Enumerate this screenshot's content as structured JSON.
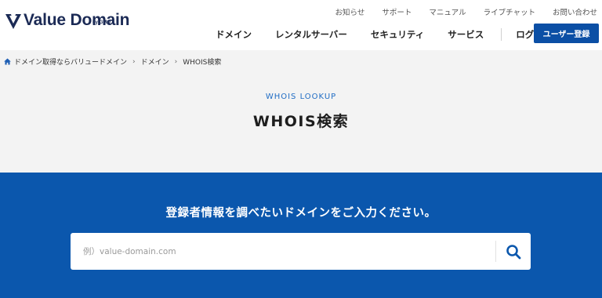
{
  "logo": {
    "text": "Value Domain",
    "sub": "by GMO",
    "icon": "value-domain-logo-mark"
  },
  "util_nav": [
    "お知らせ",
    "サポート",
    "マニュアル",
    "ライブチャット",
    "お問い合わせ"
  ],
  "main_nav": [
    "ドメイン",
    "レンタルサーバー",
    "セキュリティ",
    "サービス"
  ],
  "login_label": "ログイン",
  "register_label": "ユーザー登録",
  "breadcrumb": {
    "icon": "home-icon",
    "items": [
      "ドメイン取得ならバリュードメイン",
      "ドメイン",
      "WHOIS検索"
    ]
  },
  "hero": {
    "eyebrow": "WHOIS LOOKUP",
    "title": "WHOIS検索"
  },
  "search": {
    "prompt": "登録者情報を調べたいドメインをご入力ください。",
    "placeholder": "例）value-domain.com",
    "value": "",
    "icon": "search-icon"
  },
  "colors": {
    "brand_blue": "#0b57ad",
    "button_blue": "#0b4fa5",
    "logo_navy": "#1b2a55",
    "eyebrow_blue": "#1f6cc4"
  }
}
